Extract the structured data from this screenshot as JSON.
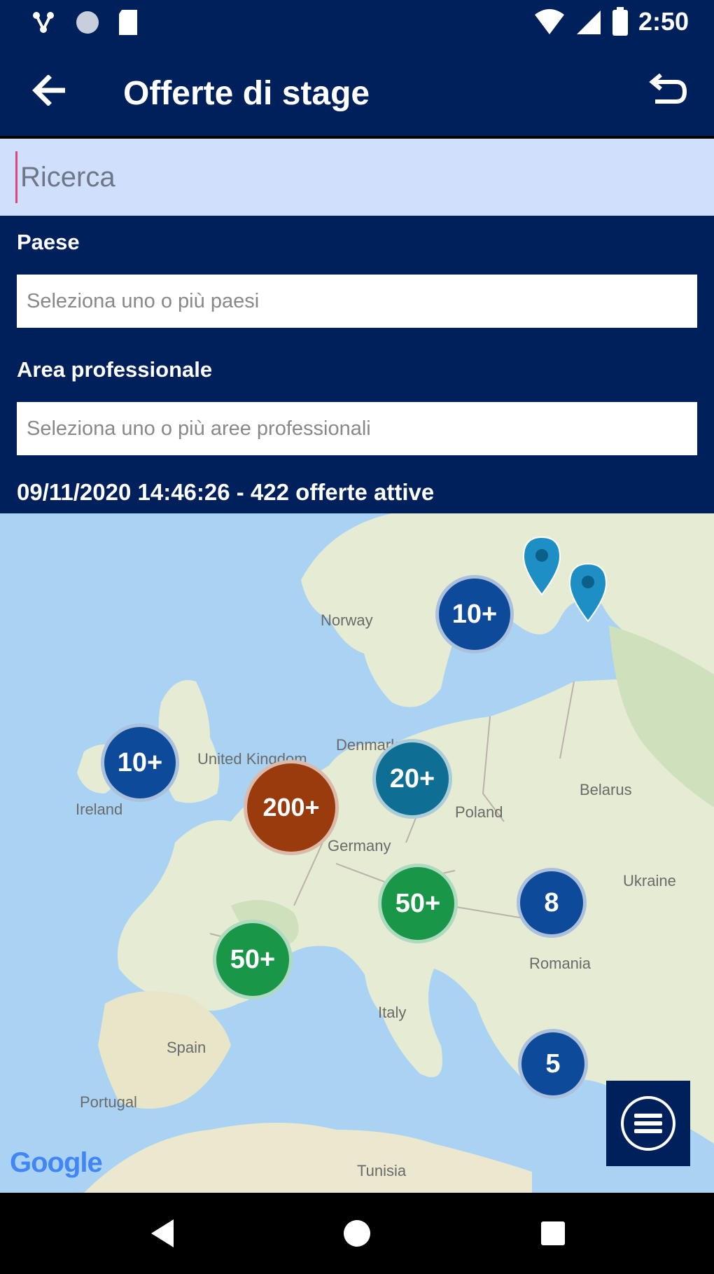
{
  "status_bar": {
    "time": "2:50",
    "icons": [
      "network-icon",
      "circle-icon",
      "sd-card-icon",
      "wifi-icon",
      "cell-signal-icon",
      "battery-icon"
    ]
  },
  "app_bar": {
    "title": "Offerte di stage",
    "back_icon": "arrow-back-icon",
    "action_icon": "undo-icon"
  },
  "search": {
    "placeholder": "Ricerca"
  },
  "filters": {
    "country_label": "Paese",
    "country_placeholder": "Seleziona uno o più paesi",
    "area_label": "Area professionale",
    "area_placeholder": "Seleziona uno o più aree professionali",
    "updated": "09/11/2020 14:46:26 - 422 offerte attive"
  },
  "map": {
    "country_labels": [
      "Norway",
      "United Kingdom",
      "Ireland",
      "Denmark",
      "Poland",
      "Germany",
      "Belarus",
      "Ukraine",
      "Romania",
      "Italy",
      "Spain",
      "Portugal",
      "Tunisia"
    ],
    "clusters": [
      {
        "label": "10+",
        "color": "#0d4a9a"
      },
      {
        "label": "10+",
        "color": "#0d4a9a"
      },
      {
        "label": "200+",
        "color": "#9a3b0e"
      },
      {
        "label": "20+",
        "color": "#0f6e93"
      },
      {
        "label": "50+",
        "color": "#199648"
      },
      {
        "label": "50+",
        "color": "#199648"
      },
      {
        "label": "8",
        "color": "#0d4a9a"
      },
      {
        "label": "5",
        "color": "#0d4a9a"
      }
    ],
    "pin_color": "#1e8fc4",
    "attribution": "Google"
  },
  "nav_bar": {
    "back": "nav-back-icon",
    "home": "nav-home-icon",
    "recents": "nav-recents-icon"
  },
  "colors": {
    "primary": "#00205b",
    "search_bg": "#d0e0fc",
    "land": "#e8edd8",
    "water": "#aad3f3"
  }
}
